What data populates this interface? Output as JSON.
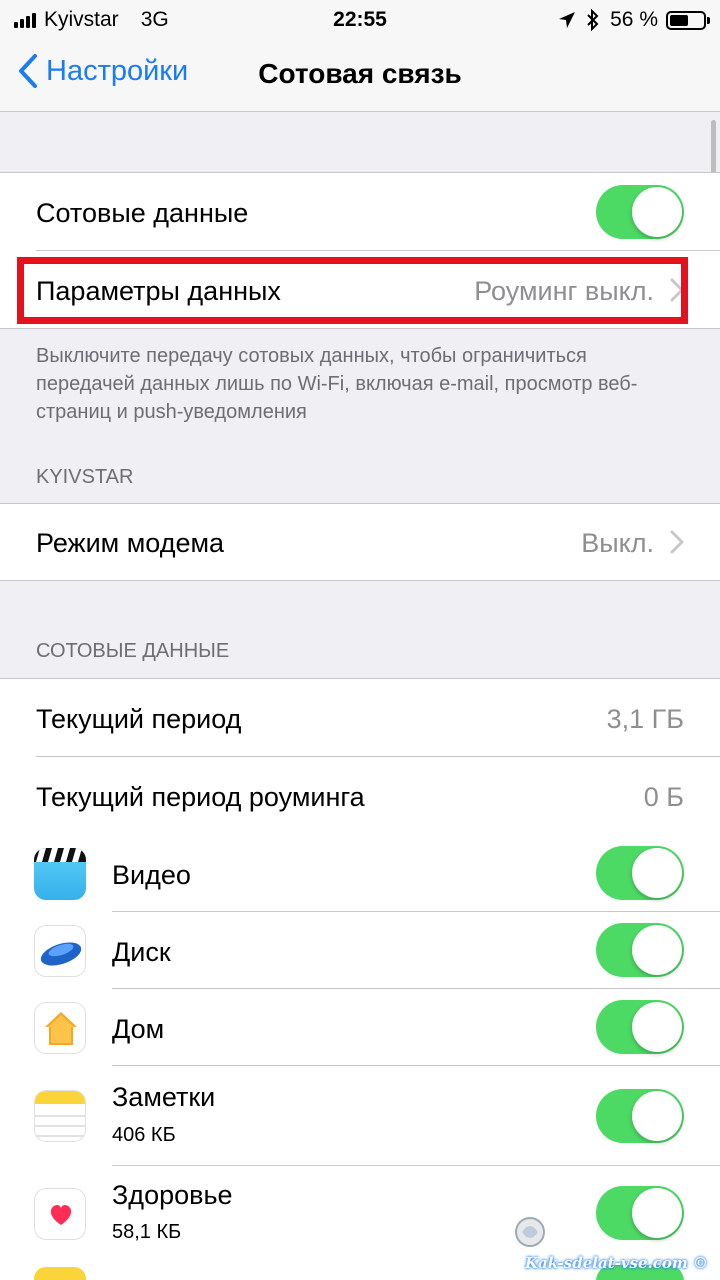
{
  "status_bar": {
    "carrier": "Kyivstar",
    "network": "3G",
    "time": "22:55",
    "battery_percent": "56 %",
    "battery_level": 0.56
  },
  "navbar": {
    "back_label": "Настройки",
    "title": "Сотовая связь"
  },
  "main_group": {
    "cellular_data": {
      "label": "Сотовые данные",
      "on": true
    },
    "data_options": {
      "label": "Параметры данных",
      "value": "Роуминг выкл."
    },
    "footer": "Выключите передачу сотовых данных, чтобы ограничиться передачей данных лишь по Wi-Fi, включая e-mail, просмотр веб-страниц и push-уведомления"
  },
  "carrier_section": {
    "header": "KYIVSTAR",
    "hotspot": {
      "label": "Режим модема",
      "value": "Выкл."
    }
  },
  "usage_section": {
    "header": "СОТОВЫЕ ДАННЫЕ",
    "current_period": {
      "label": "Текущий период",
      "value": "3,1 ГБ"
    },
    "roaming_period": {
      "label": "Текущий период роуминга",
      "value": "0 Б"
    },
    "apps": [
      {
        "name": "Видео",
        "usage": "",
        "icon": "videos-app-icon",
        "on": true
      },
      {
        "name": "Диск",
        "usage": "",
        "icon": "yandex-disk-app-icon",
        "on": true
      },
      {
        "name": "Дом",
        "usage": "",
        "icon": "home-app-icon",
        "on": true
      },
      {
        "name": "Заметки",
        "usage": "406 КБ",
        "icon": "notes-app-icon",
        "on": true
      },
      {
        "name": "Здоровье",
        "usage": "58,1 КБ",
        "icon": "health-app-icon",
        "on": true
      }
    ]
  },
  "colors": {
    "accent": "#1a7cf5",
    "toggle_on": "#4cd964",
    "highlight": "#e3121d"
  },
  "watermark": "Kak-sdelat-vse.com ©"
}
